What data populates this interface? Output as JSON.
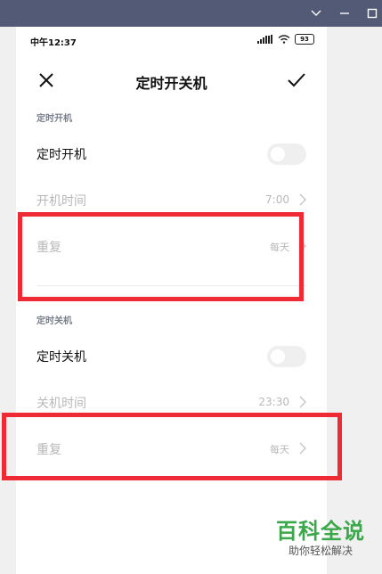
{
  "status": {
    "time": "中午12:37",
    "battery": "93"
  },
  "header": {
    "title": "定时开关机"
  },
  "power_on": {
    "section_label": "定时开机",
    "toggle_label": "定时开机",
    "toggle_on": false,
    "time_label": "开机时间",
    "time_value": "7:00",
    "repeat_label": "重复",
    "repeat_value": "每天"
  },
  "power_off": {
    "section_label": "定时关机",
    "toggle_label": "定时关机",
    "toggle_on": false,
    "time_label": "关机时间",
    "time_value": "23:30",
    "repeat_label": "重复",
    "repeat_value": "每天"
  },
  "watermark": {
    "title": "百科全说",
    "subtitle": "助你轻松解决"
  },
  "colors": {
    "highlight": "#ee2b35",
    "window_bar": "#525a76",
    "watermark_green": "#3aa84a"
  }
}
